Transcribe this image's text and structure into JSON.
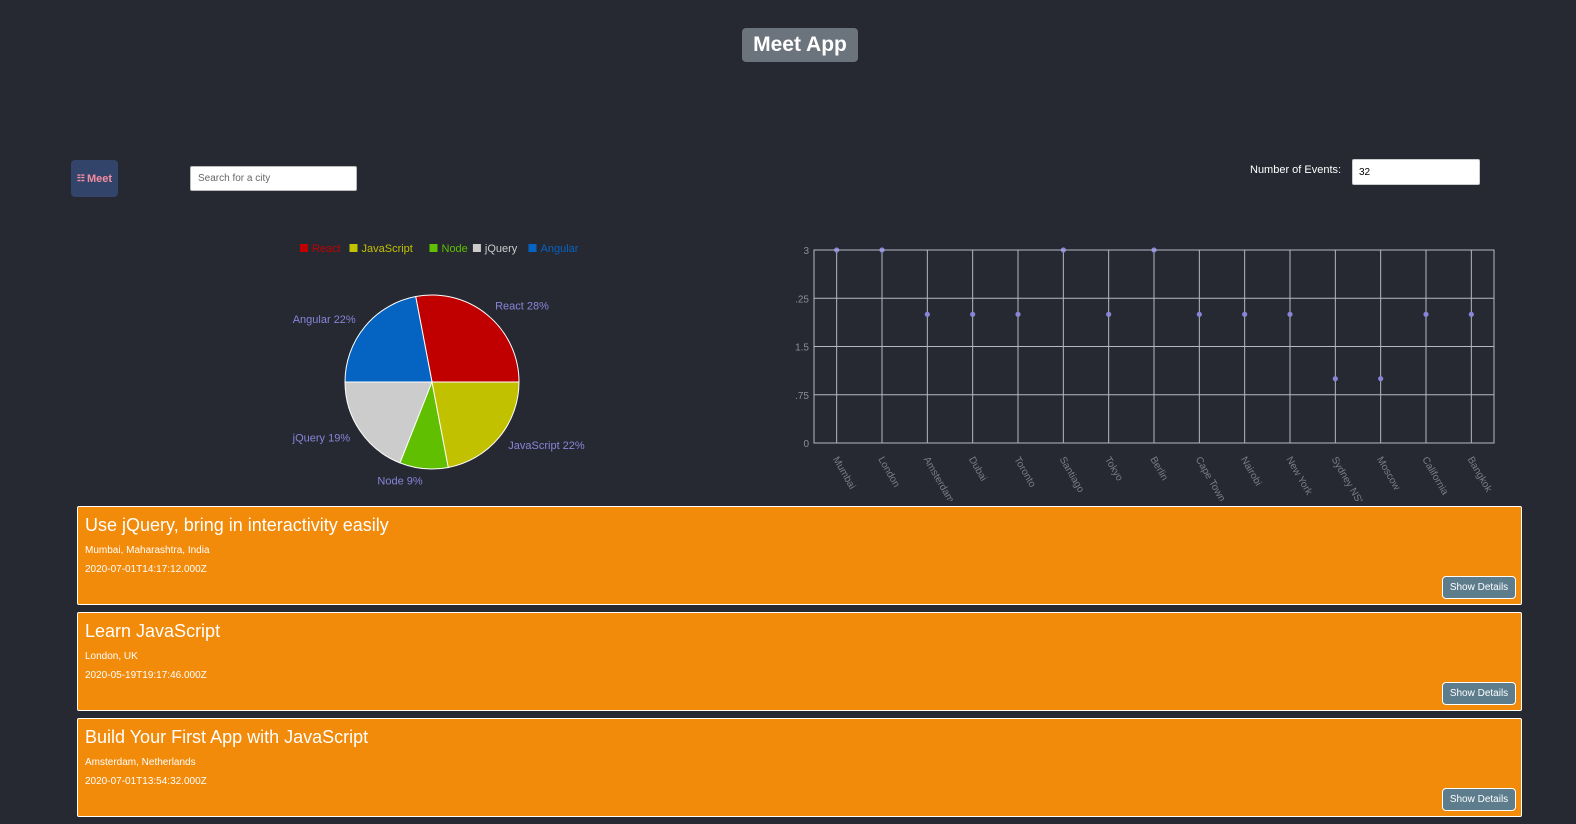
{
  "header": {
    "app_title": "Meet App"
  },
  "logo": {
    "text": "Meet",
    "icon": "calendar-icon"
  },
  "search": {
    "placeholder": "Search for a city",
    "value": ""
  },
  "number_of_events": {
    "label": "Number of Events:",
    "value": "32"
  },
  "colors": {
    "background": "#262932",
    "event_card": "#f28a0a",
    "details_button": "#5d7d8d",
    "title_badge": "#6b737c",
    "scatter_point": "#8884d8"
  },
  "chart_data": [
    {
      "type": "pie",
      "legend_position": "top",
      "slices": [
        {
          "name": "React",
          "value": 28,
          "label": "React 28%",
          "color": "#c00000"
        },
        {
          "name": "Angular",
          "value": 22,
          "label": "Angular 22%",
          "color": "#0563c1"
        },
        {
          "name": "jQuery",
          "value": 19,
          "label": "jQuery 19%",
          "color": "#cccccc"
        },
        {
          "name": "Node",
          "value": 9,
          "label": "Node 9%",
          "color": "#5fbf00"
        },
        {
          "name": "JavaScript",
          "value": 22,
          "label": "JavaScript 22%",
          "color": "#c1c100"
        }
      ],
      "legend": [
        {
          "name": "React",
          "color": "#c00000"
        },
        {
          "name": "JavaScript",
          "color": "#c1c100"
        },
        {
          "name": "Node",
          "color": "#5fbf00"
        },
        {
          "name": "jQuery",
          "color": "#cccccc"
        },
        {
          "name": "Angular",
          "color": "#0563c1"
        }
      ]
    },
    {
      "type": "scatter",
      "categories": [
        "Mumbai",
        "London",
        "Amsterdam",
        "Dubai",
        "Toronto",
        "Santiago",
        "Tokyo",
        "Berlin",
        "Cape Town",
        "Nairobi",
        "New York",
        "Sydney NSW",
        "Moscow",
        "California",
        "Bangkok"
      ],
      "values": [
        3,
        3,
        2,
        2,
        2,
        3,
        2,
        3,
        2,
        2,
        2,
        1,
        1,
        2,
        2
      ],
      "y_ticks": [
        "0",
        ".75",
        "1.5",
        ".25",
        "3"
      ],
      "ylim": [
        0,
        3
      ],
      "grid": true
    }
  ],
  "events": [
    {
      "title": "Use jQuery, bring in interactivity easily",
      "location": "Mumbai, Maharashtra, India",
      "time": "2020-07-01T14:17:12.000Z",
      "button": "Show Details"
    },
    {
      "title": "Learn JavaScript",
      "location": "London, UK",
      "time": "2020-05-19T19:17:46.000Z",
      "button": "Show Details"
    },
    {
      "title": "Build Your First App with JavaScript",
      "location": "Amsterdam, Netherlands",
      "time": "2020-07-01T13:54:32.000Z",
      "button": "Show Details"
    }
  ]
}
